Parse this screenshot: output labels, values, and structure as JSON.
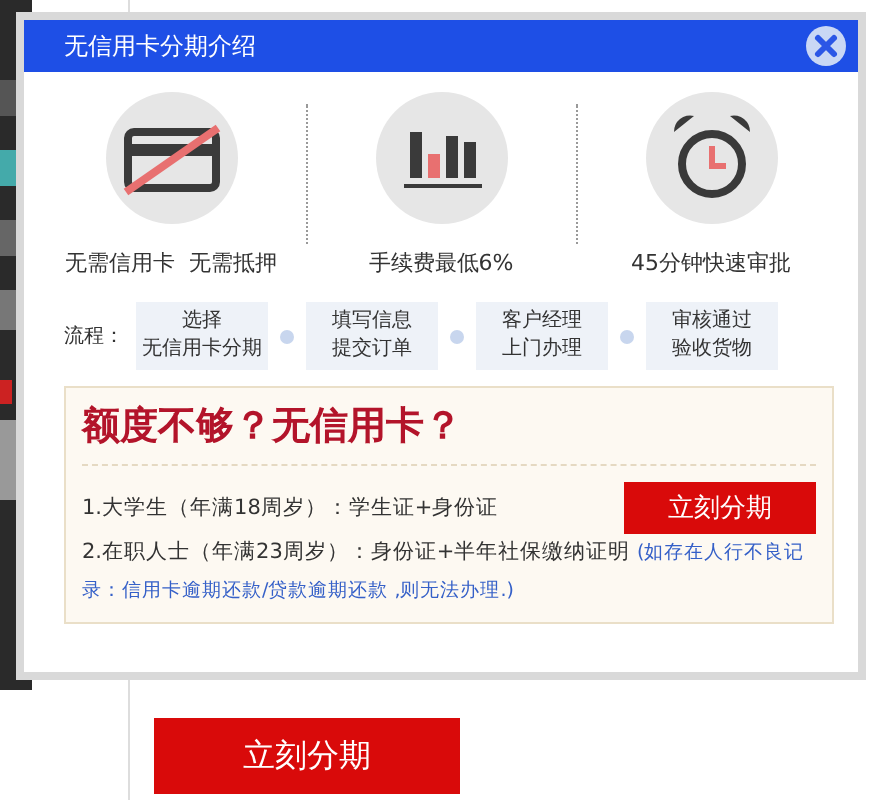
{
  "dialog": {
    "title": "无信用卡分期介绍",
    "features": [
      {
        "kind": "card",
        "label": "无需信用卡  无需抵押"
      },
      {
        "kind": "chart",
        "label": "手续费最低6%"
      },
      {
        "kind": "clock",
        "label": "45分钟快速审批"
      }
    ],
    "process": {
      "label": "流程：",
      "steps": [
        [
          "选择",
          "无信用卡分期"
        ],
        [
          "填写信息",
          "提交订单"
        ],
        [
          "客户经理",
          "上门办理"
        ],
        [
          "审核通过",
          "验收货物"
        ]
      ]
    },
    "promo": {
      "heading": "额度不够？无信用卡？",
      "requirements": [
        "1.大学生（年满18周岁）：学生证+身份证",
        "2.在职人士（年满23周岁）：身份证+半年社保缴纳证明"
      ],
      "note": "(如存在人行不良记录：信用卡逾期还款/贷款逾期还款 ,则无法办理.)",
      "button": "立刻分期"
    }
  },
  "page": {
    "button": "立刻分期"
  }
}
